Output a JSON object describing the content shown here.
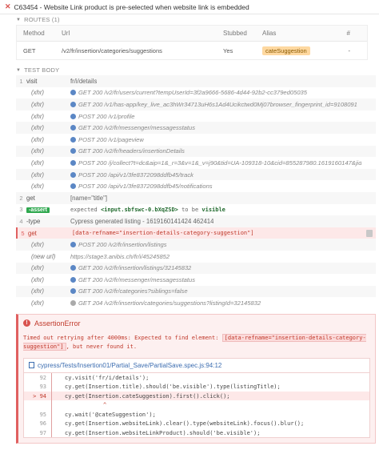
{
  "test": {
    "title": "C63454 - Website Link product is pre-selected when website link is embedded"
  },
  "routes": {
    "header": "ROUTES (1)",
    "columns": [
      "Method",
      "Url",
      "Stubbed",
      "Alias",
      "#"
    ],
    "rows": [
      {
        "method": "GET",
        "url": "/v2/fr/insertion/categories/suggestions",
        "stubbed": "Yes",
        "alias": "cateSuggestion",
        "count": "-"
      }
    ]
  },
  "test_body": {
    "header": "TEST BODY",
    "commands": [
      {
        "num": "1",
        "name": "visit",
        "msg": "fr/i/details",
        "type": "plain"
      },
      {
        "num": "",
        "name": "(xhr)",
        "msg": "GET 200 /v2/fr/users/current?tempUserId=3f2a9666-5686-4d44-92b2-cc379ed05035",
        "type": "xhr",
        "dot": "blue"
      },
      {
        "num": "",
        "name": "(xhr)",
        "msg": "GET 200 /v1/has-app/key_live_ac3hWr34713uH6s1Ad4Ucikctwd0Mj07browser_fingerprint_id=9108091",
        "type": "xhr",
        "dot": "blue"
      },
      {
        "num": "",
        "name": "(xhr)",
        "msg": "POST 200 /v1/profile",
        "type": "xhr",
        "dot": "blue"
      },
      {
        "num": "",
        "name": "(xhr)",
        "msg": "GET 200 /v2/fr/messenger/messagesstatus",
        "type": "xhr",
        "dot": "blue"
      },
      {
        "num": "",
        "name": "(xhr)",
        "msg": "POST 200 /v1/pageview",
        "type": "xhr",
        "dot": "blue"
      },
      {
        "num": "",
        "name": "(xhr)",
        "msg": "GET 200 /v2/fr/headers/insertionDetails",
        "type": "xhr",
        "dot": "blue"
      },
      {
        "num": "",
        "name": "(xhr)",
        "msg": "POST 200 /j/collect?t=dc&aip=1&_r=3&v=1&_v=j90&tid=UA-109318-10&cid=855287980.1619160147&jid",
        "type": "xhr",
        "dot": "blue"
      },
      {
        "num": "",
        "name": "(xhr)",
        "msg": "POST 200 /api/v1/3fe8372098ddfb45/track",
        "type": "xhr",
        "dot": "blue"
      },
      {
        "num": "",
        "name": "(xhr)",
        "msg": "POST 200 /api/v1/3fe8372098ddfb45/notifications",
        "type": "xhr",
        "dot": "blue"
      },
      {
        "num": "2",
        "name": "get",
        "msg": "[name=\"title\"]",
        "type": "plain"
      },
      {
        "num": "3",
        "name": "-assert",
        "assert_prefix": "expected ",
        "assert_subject": "<input.sbfswc-0.bXqZSD>",
        "assert_mid": " to be ",
        "assert_end": "visible",
        "type": "assert"
      },
      {
        "num": "4",
        "name": "-type",
        "msg": "Cypress generated listing - 1619160141424 462414",
        "type": "plain"
      },
      {
        "num": "5",
        "name": "get",
        "msg": "[data-refname=\"insertion-details-category-suggestion\"]",
        "type": "err"
      },
      {
        "num": "",
        "name": "(xhr)",
        "msg": "POST 200 /v2/fr/insertion/listings",
        "type": "xhr",
        "dot": "blue"
      },
      {
        "num": "",
        "name": "(new url)",
        "msg": "https://stage3.anibis.ch/fr/i/45245852",
        "type": "xhr",
        "dot": "none"
      },
      {
        "num": "",
        "name": "(xhr)",
        "msg": "GET 200 /v2/fr/insertion/listings/32145832",
        "type": "xhr",
        "dot": "blue"
      },
      {
        "num": "",
        "name": "(xhr)",
        "msg": "GET 200 /v2/fr/messenger/messagesstatus",
        "type": "xhr",
        "dot": "blue"
      },
      {
        "num": "",
        "name": "(xhr)",
        "msg": "GET 200 /v2/fr/categories?siblings=false",
        "type": "xhr",
        "dot": "blue"
      },
      {
        "num": "",
        "name": "(xhr)",
        "msg": "GET 204 /v2/fr/insertion/categories/suggestions?listingId=32145832",
        "type": "xhr",
        "dot": "grey"
      }
    ]
  },
  "error": {
    "title": "AssertionError",
    "message_before": "Timed out retrying after 4000ms: Expected to find element: ",
    "message_highlight": "[data-refname=\"insertion-details-category-suggestion\"]",
    "message_after": ", but never found it.",
    "file_link": "cypress/Tests/Insertion01/Partial_Save/PartialSave.spec.js:94:12",
    "code": [
      {
        "ln": "92",
        "text": "cy.visit('fr/i/details');",
        "highlight": false
      },
      {
        "ln": "93",
        "text": "cy.get(Insertion.title).should('be.visible').type(listingTitle);",
        "highlight": false
      },
      {
        "ln": "> 94",
        "text": "cy.get(Insertion.cateSuggestion).first().click();",
        "highlight": true
      },
      {
        "ln": "",
        "text": "^",
        "highlight": false
      },
      {
        "ln": "95",
        "text": "cy.wait('@cateSuggestion');",
        "highlight": false
      },
      {
        "ln": "96",
        "text": "cy.get(Insertion.websiteLink).clear().type(websiteLink).focus().blur();",
        "highlight": false
      },
      {
        "ln": "97",
        "text": "cy.get(Insertion.websiteLinkProduct).should('be.visible');",
        "highlight": false
      }
    ]
  }
}
